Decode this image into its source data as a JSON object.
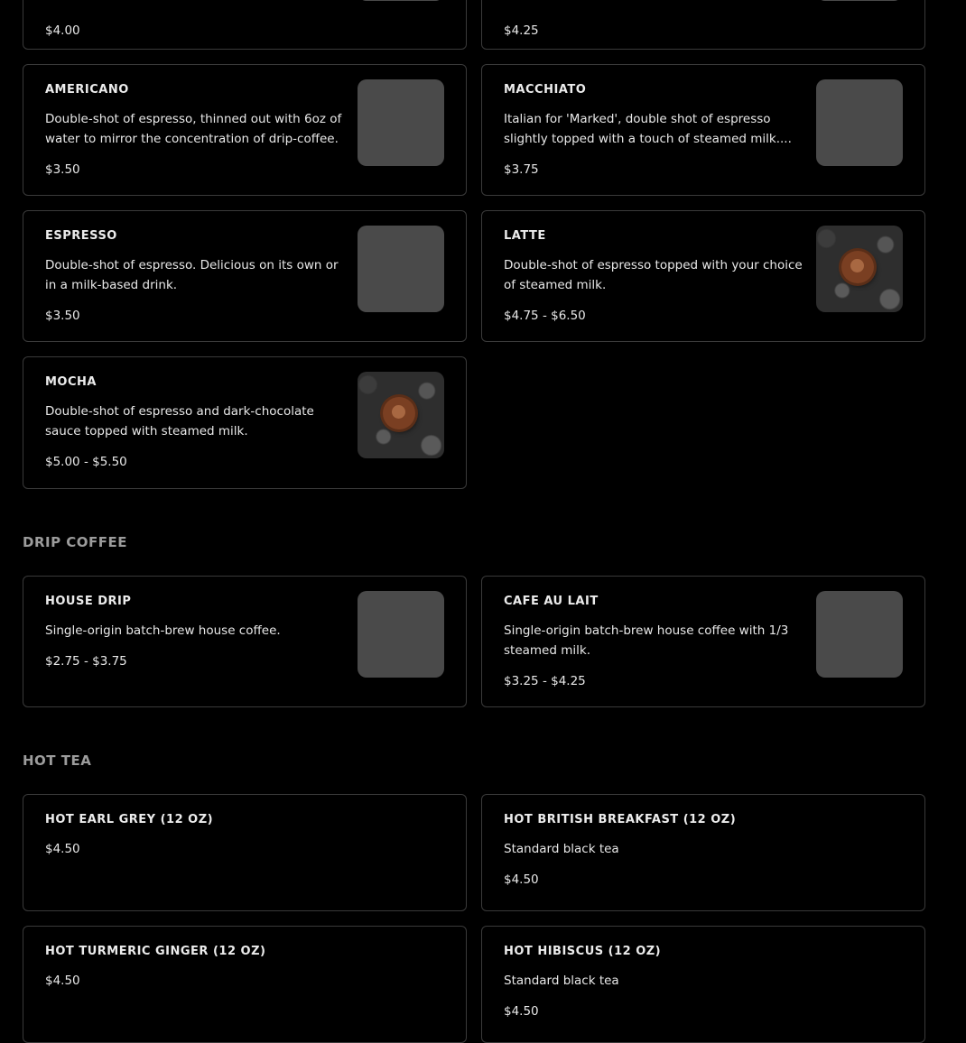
{
  "top_partial": {
    "left_price": "$4.00",
    "right_price": "$4.25"
  },
  "espresso_items": [
    {
      "name": "Americano",
      "description": "Double-shot of espresso, thinned out with 6oz of water to mirror the concentration of drip-coffee.",
      "price": "$3.50",
      "image": "placeholder"
    },
    {
      "name": "Macchiato",
      "description": "Italian for 'Marked', double shot of espresso slightly topped with a touch of steamed milk....",
      "price": "$3.75",
      "image": "placeholder"
    },
    {
      "name": "Espresso",
      "description": "Double-shot of espresso. Delicious on its own or in a milk-based drink.",
      "price": "$3.50",
      "image": "placeholder"
    },
    {
      "name": "Latte",
      "description": "Double-shot of espresso topped with your choice of steamed milk.",
      "price": "$4.75 - $6.50",
      "image": "latte-photo"
    },
    {
      "name": "Mocha",
      "description": "Double-shot of espresso and dark-chocolate sauce topped with steamed milk.",
      "price": "$5.00 - $5.50",
      "image": "latte-photo"
    }
  ],
  "drip_section": {
    "title": "Drip Coffee",
    "items": [
      {
        "name": "House Drip",
        "description": "Single-origin batch-brew house coffee.",
        "price": "$2.75 - $3.75",
        "image": "placeholder"
      },
      {
        "name": "Cafe Au Lait",
        "description": "Single-origin batch-brew house coffee with 1/3 steamed milk.",
        "price": "$3.25 - $4.25",
        "image": "placeholder"
      }
    ]
  },
  "tea_section": {
    "title": "Hot Tea",
    "items": [
      {
        "name": "Hot Earl Grey (12 oz)",
        "price": "$4.50"
      },
      {
        "name": "Hot British Breakfast (12 oz)",
        "description": "Standard black tea",
        "price": "$4.50"
      },
      {
        "name": "Hot Turmeric Ginger (12 oz)",
        "price": "$4.50"
      },
      {
        "name": "Hot Hibiscus (12 oz)",
        "description": "Standard black tea",
        "price": "$4.50"
      }
    ]
  },
  "colors": {
    "background": "#000000",
    "card_border": "#3a3a3a",
    "placeholder": "#4a4a4a",
    "section_title": "#9c9c9c"
  }
}
